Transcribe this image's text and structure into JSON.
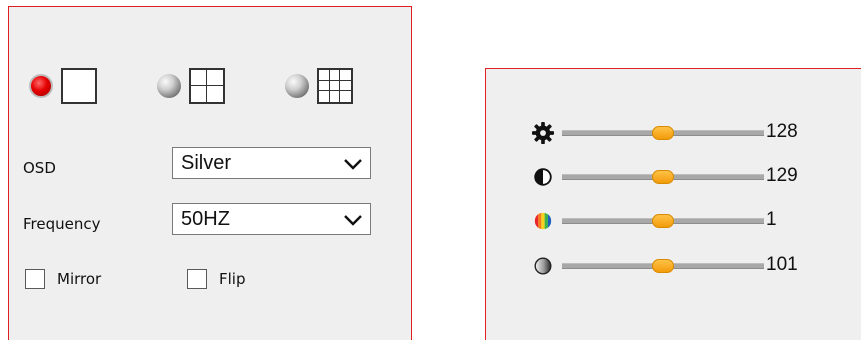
{
  "layout": {
    "options": [
      {
        "cells": 1,
        "selected": true
      },
      {
        "cells": 4,
        "selected": false
      },
      {
        "cells": 9,
        "selected": false
      }
    ]
  },
  "osd": {
    "label": "OSD",
    "value": "Silver"
  },
  "frequency": {
    "label": "Frequency",
    "value": "50HZ"
  },
  "mirror": {
    "label": "Mirror",
    "checked": false
  },
  "flip": {
    "label": "Flip",
    "checked": false
  },
  "sliders": [
    {
      "name": "brightness",
      "icon": "gear-icon",
      "value": "128",
      "level": 0.5
    },
    {
      "name": "contrast",
      "icon": "contrast-icon",
      "value": "129",
      "level": 0.5
    },
    {
      "name": "hue",
      "icon": "color-wheel-icon",
      "value": "1",
      "level": 0.5
    },
    {
      "name": "saturation",
      "icon": "saturation-icon",
      "value": "101",
      "level": 0.5
    }
  ],
  "colors": {
    "accent_border": "#e02020",
    "panel_bg": "#efefef",
    "thumb": "#f5a623",
    "radio_selected": "#e50000"
  }
}
